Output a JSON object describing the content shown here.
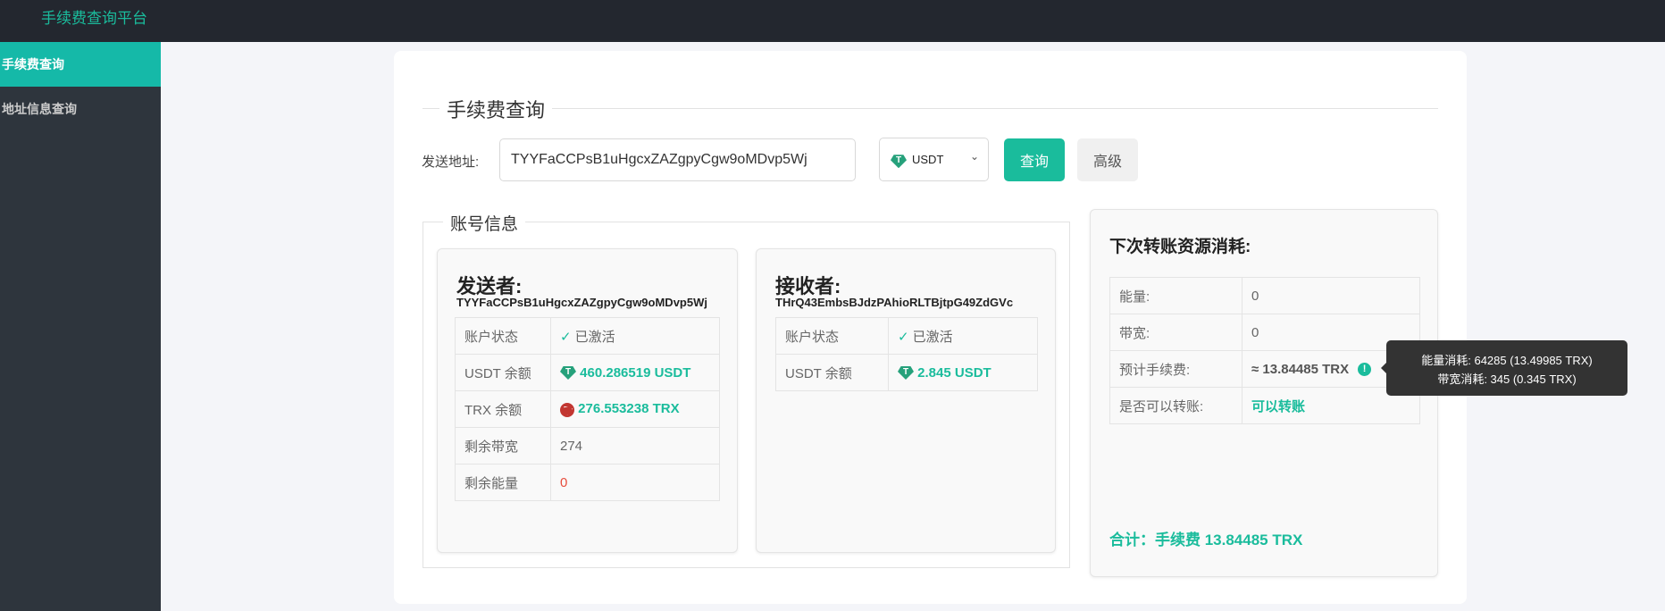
{
  "header": {
    "brand": "手续费查询平台"
  },
  "sidebar": {
    "items": [
      {
        "label": "手续费查询",
        "active": true
      },
      {
        "label": "地址信息查询",
        "active": false
      }
    ]
  },
  "query": {
    "section_title": "手续费查询",
    "address_label": "发送地址:",
    "address_value": "TYYFaCCPsB1uHgcxZAZgpyCgw9oMDvp5Wj",
    "token": "USDT",
    "token_icon": "tether-icon",
    "query_button": "查询",
    "advanced_button": "高级"
  },
  "account": {
    "section_title": "账号信息",
    "sender": {
      "title": "发送者:",
      "address": "TYYFaCCPsB1uHgcxZAZgpyCgw9oMDvp5Wj",
      "rows": [
        {
          "label": "账户状态",
          "value": "已激活"
        },
        {
          "label": "USDT 余额",
          "value": "460.286519 USDT"
        },
        {
          "label": "TRX 余额",
          "value": "276.553238 TRX"
        },
        {
          "label": "剩余带宽",
          "value": "274"
        },
        {
          "label": "剩余能量",
          "value": "0"
        }
      ]
    },
    "receiver": {
      "title": "接收者:",
      "address": "THrQ43EmbsBJdzPAhioRLTBjtpG49ZdGVc",
      "rows": [
        {
          "label": "账户状态",
          "value": "已激活"
        },
        {
          "label": "USDT 余额",
          "value": "2.845 USDT"
        }
      ]
    }
  },
  "resources": {
    "title": "下次转账资源消耗:",
    "rows": [
      {
        "label": "能量:",
        "value": "0"
      },
      {
        "label": "带宽:",
        "value": "0"
      },
      {
        "label": "预计手续费:",
        "value": "≈ 13.84485 TRX"
      },
      {
        "label": "是否可以转账:",
        "value": "可以转账"
      }
    ],
    "total": "合计：手续费 13.84485 TRX",
    "tooltip": {
      "line1": "能量消耗: 64285 (13.49985 TRX)",
      "line2": "带宽消耗: 345 (0.345 TRX)"
    }
  },
  "colors": {
    "accent": "#1abc9c",
    "header": "#23272f",
    "sidebar": "#2e353d",
    "error": "#e74c3c"
  }
}
